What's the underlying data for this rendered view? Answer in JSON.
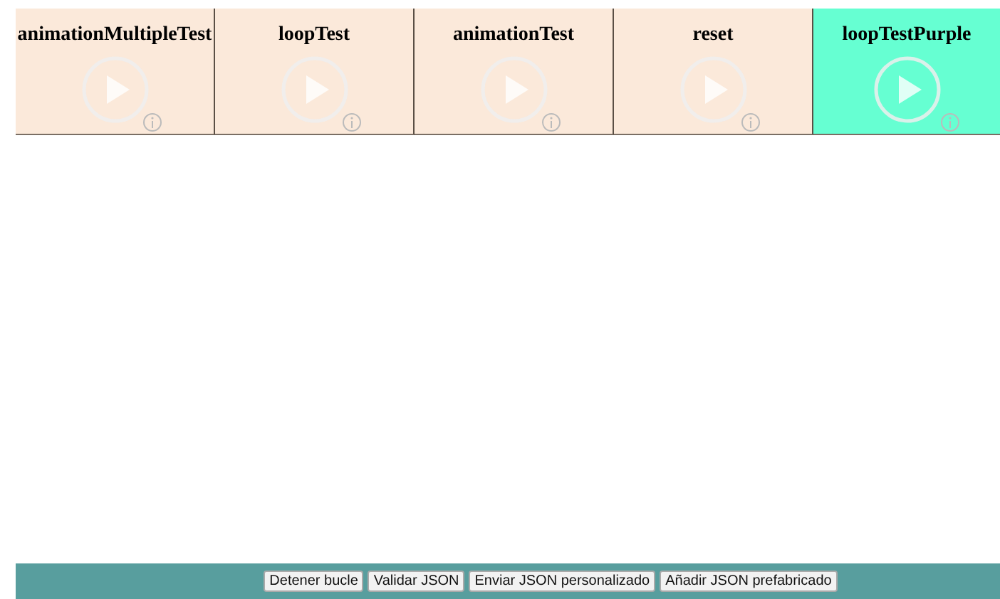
{
  "tests": [
    {
      "name": "animationMultipleTest",
      "selected": false
    },
    {
      "name": "loopTest",
      "selected": false
    },
    {
      "name": "animationTest",
      "selected": false
    },
    {
      "name": "reset",
      "selected": false
    },
    {
      "name": "loopTestPurple",
      "selected": true
    }
  ],
  "footer": {
    "buttons": [
      "Detener bucle",
      "Validar JSON",
      "Enviar JSON personalizado",
      "Añadir JSON prefabricado"
    ]
  }
}
